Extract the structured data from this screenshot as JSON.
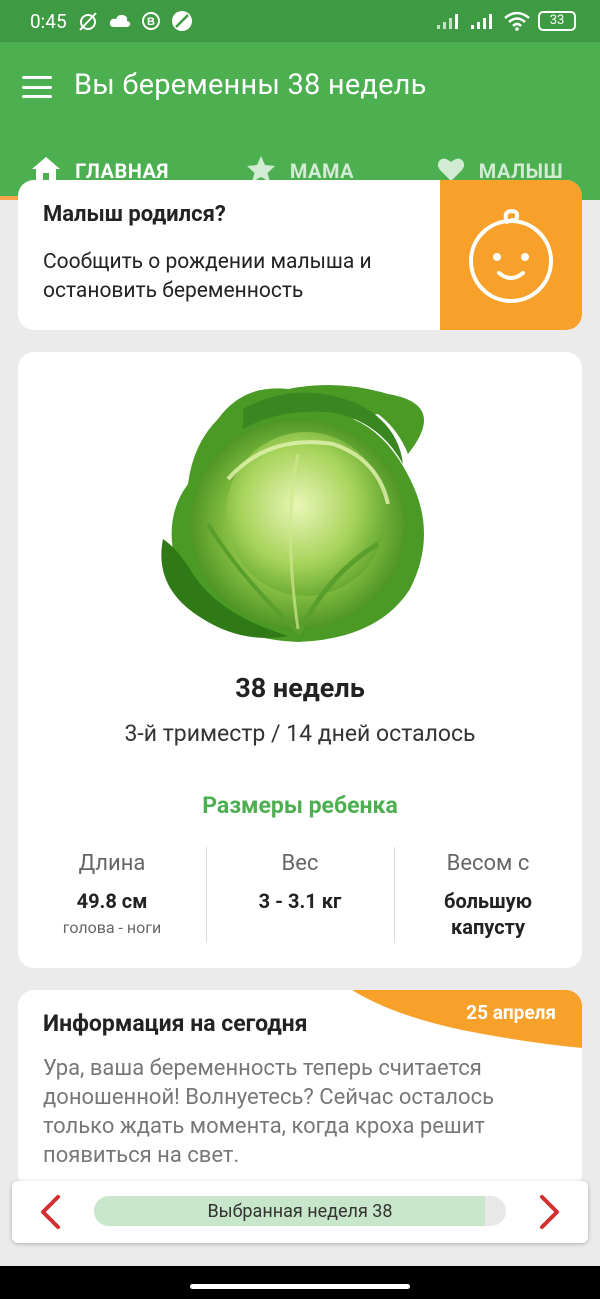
{
  "status_bar": {
    "time": "0:45",
    "battery": "33",
    "icons": [
      "muted-alarm-icon",
      "cloud-icon",
      "b-circle-icon",
      "leaf-icon",
      "signal-icon",
      "signal-icon",
      "wifi-icon",
      "battery-icon"
    ]
  },
  "app_bar": {
    "title": "Вы беременны 38 недель",
    "menu_icon": "hamburger-menu-icon"
  },
  "tabs": [
    {
      "label": "ГЛАВНАЯ",
      "icon": "home-icon",
      "active": true
    },
    {
      "label": "МАМА",
      "icon": "star-icon",
      "active": false
    },
    {
      "label": "МАЛЫШ",
      "icon": "heart-icon",
      "active": false
    }
  ],
  "born_card": {
    "heading": "Малыш родился?",
    "text": "Сообщить о рождении малыша и остановить беременность",
    "icon": "baby-face-icon"
  },
  "week_card": {
    "image": "cabbage-image",
    "title": "38 недель",
    "subtitle": "3-й триместр / 14 дней осталось",
    "sizes_title": "Размеры ребенка",
    "sizes": [
      {
        "label": "Длина",
        "value": "49.8 см",
        "note": "голова - ноги"
      },
      {
        "label": "Вес",
        "value": "3 - 3.1 кг",
        "note": ""
      },
      {
        "label": "Весом с",
        "value": "большую капусту",
        "note": ""
      }
    ]
  },
  "info_card": {
    "heading": "Информация на сегодня",
    "date": "25 апреля",
    "text": "Ура, ваша беременность теперь считается доношенной! Волнуетесь? Сейчас осталось только ждать момента, когда кроха решит появиться на свет."
  },
  "week_selector": {
    "label": "Выбранная неделя 38",
    "progress": 0.95
  },
  "colors": {
    "status_bar": "#3e9a43",
    "app_bar": "#4caf50",
    "accent": "#f7a02a",
    "arrow": "#d32f2f",
    "progress_fill": "#c8e6c9"
  }
}
